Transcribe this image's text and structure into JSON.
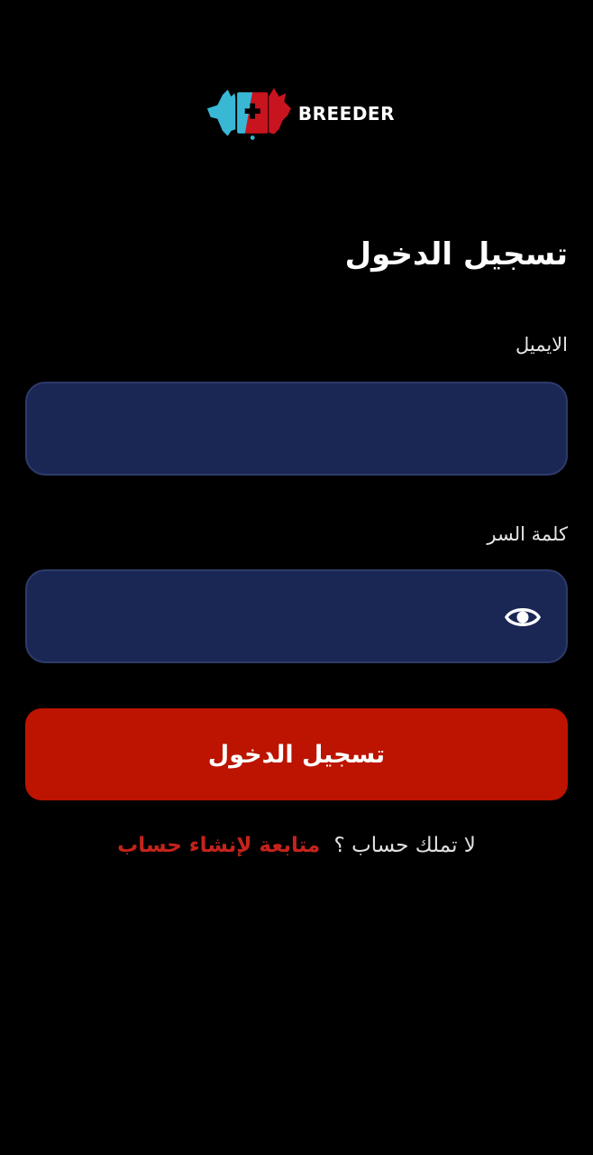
{
  "brand": {
    "name": "BREEDER",
    "logo_icon": "pets-phone-logo-icon",
    "colors": {
      "cyan": "#39b8d6",
      "red": "#c8141e"
    }
  },
  "login": {
    "title": "تسجيل الدخول",
    "email_label": "الايميل",
    "email_value": "",
    "password_label": "كلمة السر",
    "password_value": "",
    "show_password_icon": "eye-icon",
    "submit_label": "تسجيل الدخول",
    "no_account_text": "لا تملك حساب ؟",
    "signup_link_text": "متابعة لإنشاء حساب"
  },
  "colors": {
    "background": "#000000",
    "input_background": "#1a2654",
    "primary_button": "#bc1400",
    "link": "#c5231b"
  }
}
